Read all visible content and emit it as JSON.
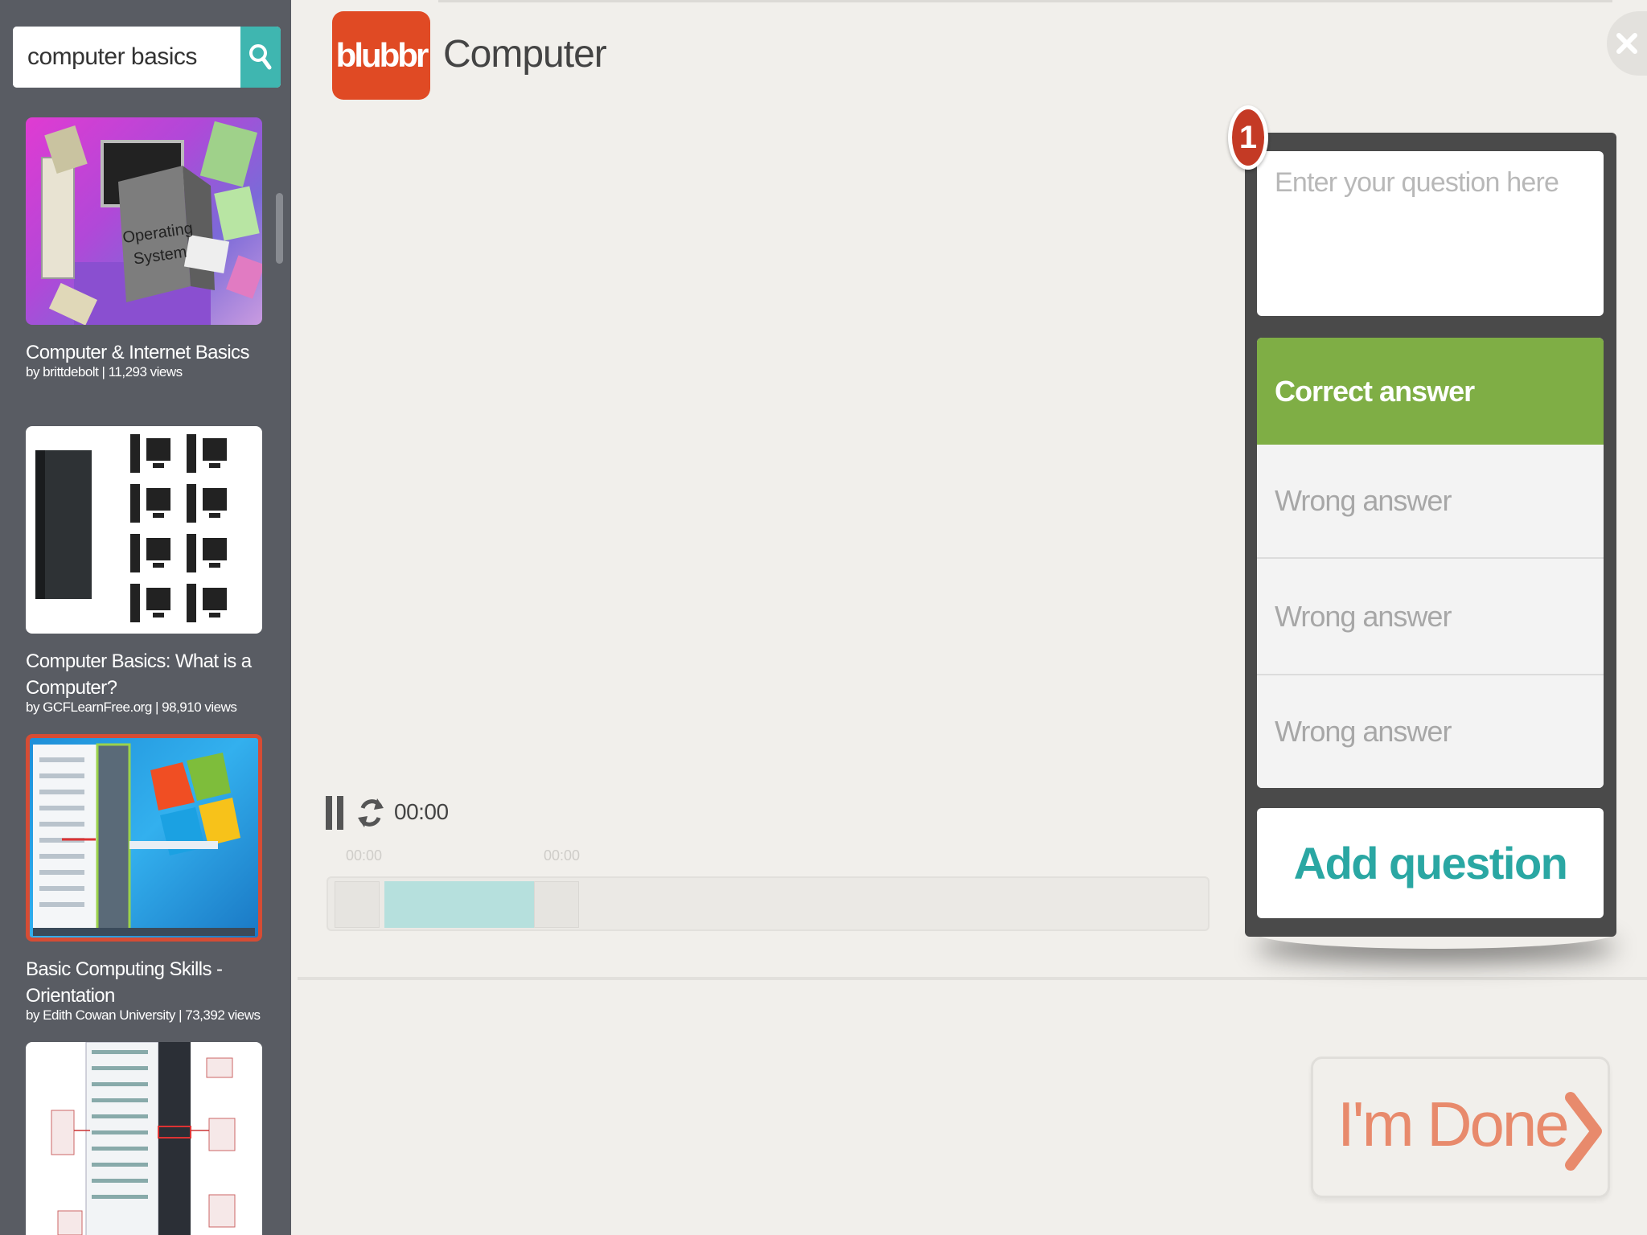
{
  "search": {
    "value": "computer basics"
  },
  "header": {
    "logo_text": "blubbr",
    "title": "Computer"
  },
  "sidebar": {
    "videos": [
      {
        "title": "Computer & Internet Basics",
        "meta": "by brittdebolt | 11,293 views"
      },
      {
        "title": "Computer Basics: What is a Computer?",
        "meta": "by GCFLearnFree.org | 98,910 views"
      },
      {
        "title": "Basic Computing Skills - Orientation",
        "meta": "by Edith Cowan University | 73,392 views"
      },
      {
        "title": "",
        "meta": ""
      }
    ],
    "thumb1_text": "Operating System"
  },
  "player": {
    "time": "00:00",
    "range_start": "00:00",
    "range_end": "00:00"
  },
  "quiz": {
    "question_number": "1",
    "question_placeholder": "Enter your question here",
    "correct_placeholder": "Correct answer",
    "wrong_placeholders": [
      "Wrong answer",
      "Wrong answer",
      "Wrong answer"
    ],
    "add_question_label": "Add question"
  },
  "done": {
    "label": "I'm Done"
  },
  "colors": {
    "brand": "#e04a24",
    "accent": "#3fb6b0",
    "correct": "#7fae45",
    "sidebar_bg": "#595c63",
    "panel_bg": "#4a4a4a",
    "done_text": "#e88a6c"
  },
  "icons": [
    "search-icon",
    "close-icon",
    "pause-icon",
    "replay-icon",
    "chevron-right-icon"
  ]
}
